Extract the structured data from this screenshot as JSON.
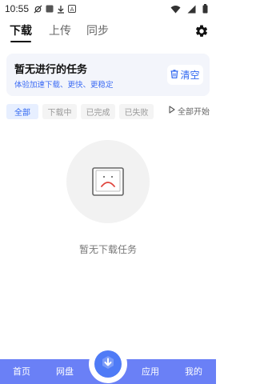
{
  "status_bar": {
    "time": "10:55",
    "icons": [
      "sync-off-icon",
      "app-square-icon",
      "download-icon",
      "notification-a-icon",
      "wifi-icon",
      "signal-icon",
      "battery-icon"
    ]
  },
  "top_tabs": [
    {
      "label": "下载",
      "active": true
    },
    {
      "label": "上传",
      "active": false
    },
    {
      "label": "同步",
      "active": false
    }
  ],
  "banner": {
    "title": "暂无进行的任务",
    "subtitle": "体验加速下载、更快、更稳定",
    "clear_label": "清空"
  },
  "filters": {
    "chips": [
      {
        "label": "全部",
        "active": true
      },
      {
        "label": "下载中",
        "active": false
      },
      {
        "label": "已完成",
        "active": false
      },
      {
        "label": "已失败",
        "active": false
      }
    ],
    "start_all_label": "全部开始"
  },
  "empty_state": {
    "text": "暂无下载任务"
  },
  "bottom_nav": {
    "items": [
      {
        "label": "首页"
      },
      {
        "label": "网盘"
      },
      {
        "label": "应用"
      },
      {
        "label": "我的"
      }
    ],
    "center_icon": "download-arrow-icon"
  },
  "colors": {
    "accent": "#2f66f0",
    "nav_bg": "#6a80f6",
    "banner_bg": "#f3f5fb"
  }
}
